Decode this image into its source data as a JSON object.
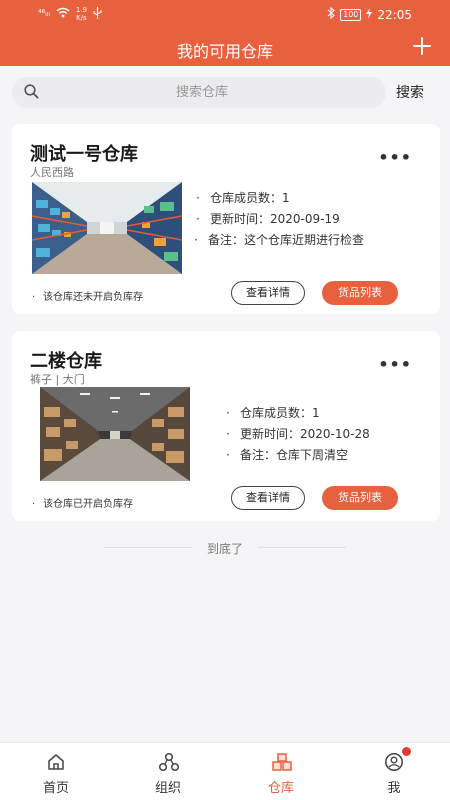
{
  "status_bar": {
    "signal": "⁴⁶ᵢₗₗ",
    "net_speed_value": "1.9",
    "net_speed_unit": "K/s",
    "battery": "100",
    "time": "22:05"
  },
  "header": {
    "title": "我的可用仓库"
  },
  "search": {
    "placeholder": "搜索仓库",
    "button_label": "搜索"
  },
  "warehouses": [
    {
      "name": "测试一号仓库",
      "address": "人民西路",
      "members_label": "仓库成员数：",
      "members_count": "1",
      "updated_label": "更新时间：",
      "updated_date": "2020-09-19",
      "remark_label": "备注：",
      "remark_text": "这个仓库近期进行检查",
      "status_note": "该仓库还未开启负库存",
      "detail_label": "查看详情",
      "goods_label": "货品列表"
    },
    {
      "name": "二楼仓库",
      "address": "裤子 | 大门",
      "members_label": "仓库成员数：",
      "members_count": "1",
      "updated_label": "更新时间：",
      "updated_date": "2020-10-28",
      "remark_label": "备注：",
      "remark_text": "仓库下周清空",
      "status_note": "该仓库已开启负库存",
      "detail_label": "查看详情",
      "goods_label": "货品列表"
    }
  ],
  "list_end": "到底了",
  "tabbar": {
    "items": [
      {
        "label": "首页",
        "icon": "home-icon"
      },
      {
        "label": "组织",
        "icon": "organization-icon"
      },
      {
        "label": "仓库",
        "icon": "warehouse-icon",
        "active": true
      },
      {
        "label": "我",
        "icon": "profile-icon",
        "has_badge": true
      }
    ]
  },
  "colors": {
    "accent": "#e8613f",
    "badge": "#e53935",
    "background": "#f5f5f7"
  }
}
